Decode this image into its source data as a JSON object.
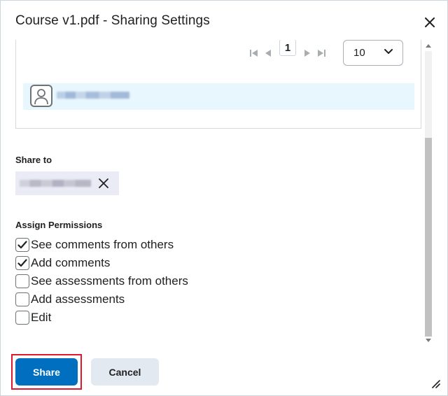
{
  "dialog": {
    "title": "Course v1.pdf - Sharing Settings"
  },
  "pager": {
    "current_page": "1",
    "per_page": "10"
  },
  "share_to": {
    "label": "Share to"
  },
  "permissions": {
    "label": "Assign Permissions",
    "items": [
      {
        "label": "See comments from others",
        "checked": true
      },
      {
        "label": "Add comments",
        "checked": true
      },
      {
        "label": "See assessments from others",
        "checked": false
      },
      {
        "label": "Add assessments",
        "checked": false
      },
      {
        "label": "Edit",
        "checked": false
      }
    ]
  },
  "footer": {
    "share_label": "Share",
    "cancel_label": "Cancel"
  },
  "colors": {
    "primary": "#006fbf",
    "selected_row": "#e8f6fd",
    "highlight": "#e0182d"
  }
}
